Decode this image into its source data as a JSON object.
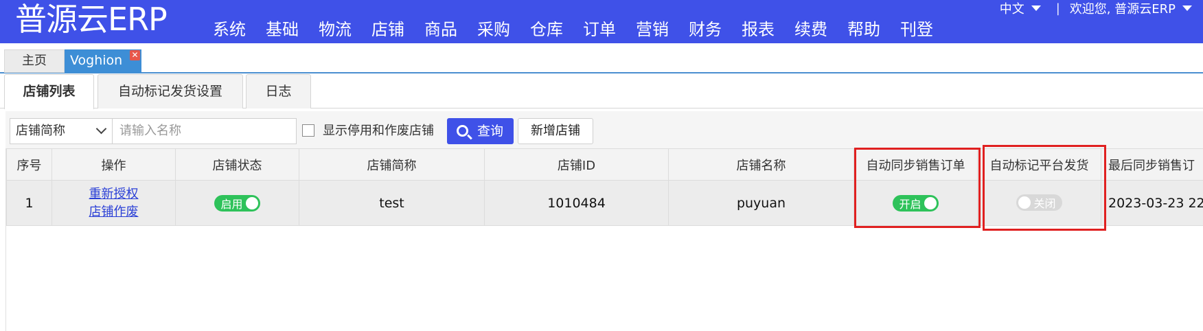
{
  "header": {
    "logo": "普源云ERP",
    "nav": [
      "系统",
      "基础",
      "物流",
      "店铺",
      "商品",
      "采购",
      "仓库",
      "订单",
      "营销",
      "财务",
      "报表",
      "续费",
      "帮助",
      "刊登"
    ],
    "language": "中文",
    "separator": "|",
    "welcome": "欢迎您, 普源云ERP",
    "accent_color": "#3f51e8"
  },
  "page_tabs": {
    "home": "主页",
    "active": "Voghion",
    "close_icon": "close-icon"
  },
  "sub_tabs": [
    "店铺列表",
    "自动标记发货设置",
    "日志"
  ],
  "toolbar": {
    "select_value": "店铺简称",
    "search_placeholder": "请输入名称",
    "checkbox_label": "显示停用和作废店铺",
    "query_label": "查询",
    "add_label": "新增店铺"
  },
  "table": {
    "columns": [
      "序号",
      "操作",
      "店铺状态",
      "店铺简称",
      "店铺ID",
      "店铺名称",
      "自动同步销售订单",
      "自动标记平台发货",
      "最后同步销售订"
    ],
    "rows": [
      {
        "index": "1",
        "actions": [
          "重新授权",
          "店铺作废"
        ],
        "status": "启用",
        "short_name": "test",
        "store_id": "1010484",
        "store_name": "puyuan",
        "auto_sync": "开启",
        "auto_mark": "关闭",
        "last_sync": "2023-03-23 22"
      }
    ]
  },
  "status_colors": {
    "on": "#2ec25a",
    "off": "#d8d8d8",
    "highlight": "#e02020"
  }
}
